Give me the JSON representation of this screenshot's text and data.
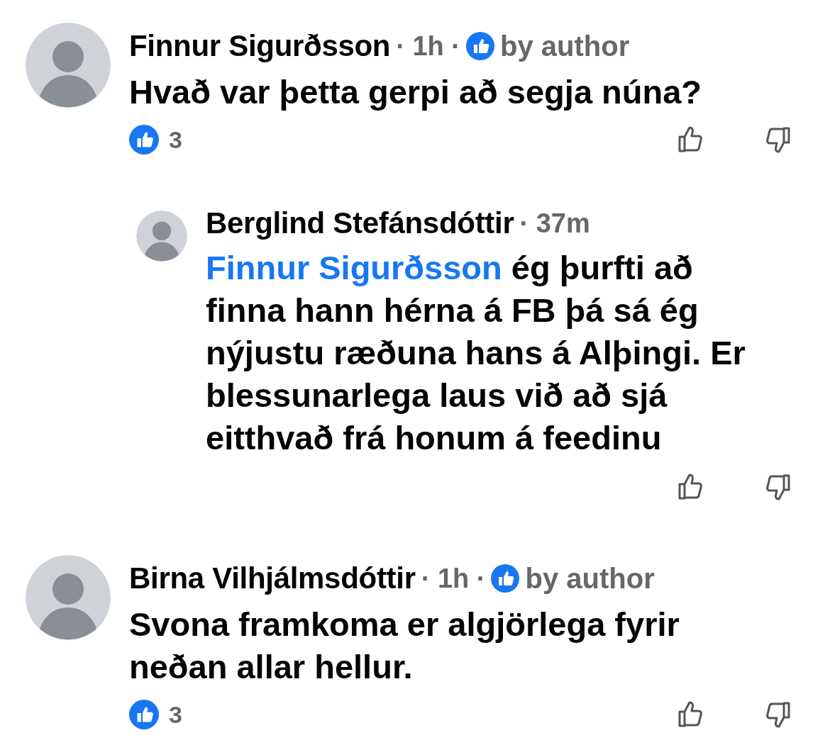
{
  "comments": [
    {
      "author": "Finnur Sigurðsson",
      "time": "· 1h ·",
      "by_author": true,
      "badge": "by author",
      "text": "Hvað var þetta gerpi að segja núna?",
      "reaction_count": "3",
      "replies": [
        {
          "author": "Berglind Stefánsdóttir",
          "time": "· 37m",
          "by_author": false,
          "mention": "Finnur Sigurðsson",
          "text": "ég þurfti að finna hann hérna á FB þá sá ég nýjustu ræðuna hans á Alþingi. Er blessunarlega laus við að sjá eitthvað frá honum á feedinu"
        }
      ]
    },
    {
      "author": "Birna Vilhjálmsdóttir",
      "time": "· 1h ·",
      "by_author": true,
      "badge": "by author",
      "text": "Svona framkoma er algjörlega fyrir neðan allar hellur.",
      "reaction_count": "3"
    }
  ]
}
